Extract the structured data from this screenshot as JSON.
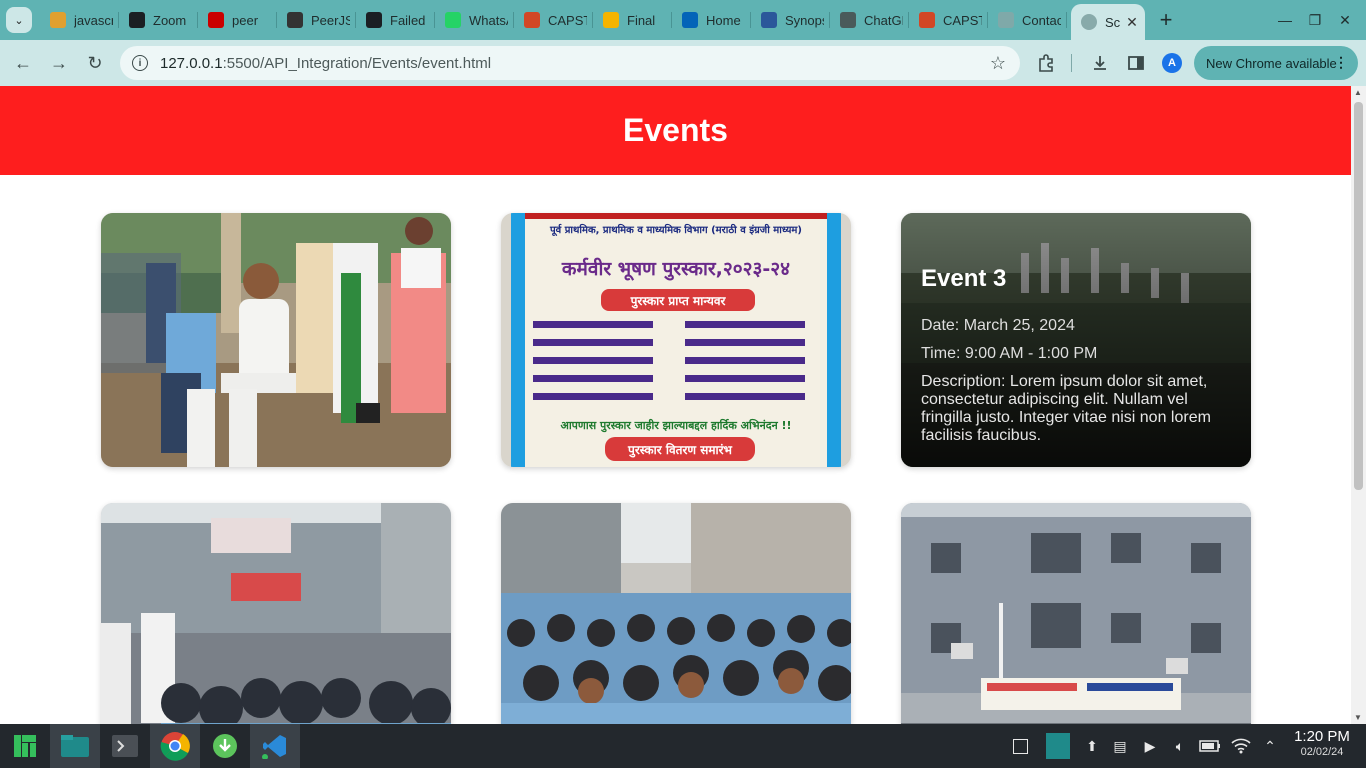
{
  "browser": {
    "tabs": [
      {
        "title": "javascript",
        "icon": "javascript-tab-icon",
        "color": "#e0a030"
      },
      {
        "title": "Zoom",
        "icon": "github-icon",
        "color": "#1b1f23"
      },
      {
        "title": "peer",
        "icon": "npm-icon",
        "color": "#cb0000"
      },
      {
        "title": "PeerJS",
        "icon": "peerjs-icon",
        "color": "#333333"
      },
      {
        "title": "Failed",
        "icon": "github-icon",
        "color": "#1b1f23"
      },
      {
        "title": "WhatsApp",
        "icon": "whatsapp-icon",
        "color": "#25d366"
      },
      {
        "title": "CAPSTONE",
        "icon": "powerpoint-icon",
        "color": "#d24726"
      },
      {
        "title": "Final",
        "icon": "drive-icon",
        "color": "#f4b400"
      },
      {
        "title": "Home",
        "icon": "onedrive-icon",
        "color": "#0364b8"
      },
      {
        "title": "Synopsis",
        "icon": "word-icon",
        "color": "#2b579a"
      },
      {
        "title": "ChatGPT",
        "icon": "chatgpt-icon",
        "color": "#4a5a5a"
      },
      {
        "title": "CAPSTONE",
        "icon": "powerpoint-icon",
        "color": "#d24726"
      },
      {
        "title": "Contact",
        "icon": "loading-icon",
        "color": "#7fa9a9"
      }
    ],
    "active_tab": {
      "title": "Sc",
      "close": "✕"
    },
    "new_tab": "+",
    "url_host": "127.0.0.1",
    "url_path": ":5500/API_Integration/Events/event.html",
    "avatar_letter": "A",
    "update_label": "New Chrome available"
  },
  "page": {
    "title": "Events",
    "event3": {
      "name": "Event 3",
      "date": "Date: March 25, 2024",
      "time": "Time: 9:00 AM - 1:00 PM",
      "description": "Description: Lorem ipsum dolor sit amet, consectetur adipiscing elit. Nullam vel fringilla justo. Integer vitae nisi non lorem facilisis faucibus."
    },
    "banner": {
      "line1": "पूर्व प्राथमिक, प्राथमिक व माध्यमिक विभाग (मराठी व इंग्रजी माध्यम)",
      "heading": "कर्मवीर भूषण पुरस्कार,२०२३-२४",
      "subheading": "पुरस्कार प्राप्त मान्यवर",
      "congrats": "आपणास पुरस्कार जाहीर झाल्याबद्दल हार्दिक अभिनंदन !!",
      "footer": "पुरस्कार वितरण समारंभ"
    },
    "colors": {
      "header": "#fe1e1e",
      "accent": "#5fb3b3"
    }
  },
  "taskbar": {
    "time": "1:20 PM",
    "date": "02/02/24"
  }
}
